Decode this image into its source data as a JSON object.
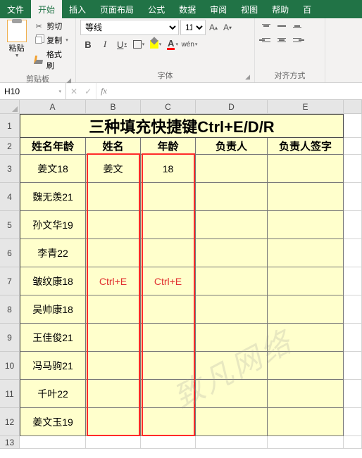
{
  "ribbon": {
    "tabs": [
      "文件",
      "开始",
      "插入",
      "页面布局",
      "公式",
      "数据",
      "审阅",
      "视图",
      "帮助",
      "百"
    ],
    "active_tab": "开始",
    "clipboard": {
      "paste": "粘贴",
      "cut": "剪切",
      "copy": "复制",
      "format_painter": "格式刷",
      "group": "剪贴板"
    },
    "font": {
      "name": "等线",
      "size": "11",
      "bold": "B",
      "italic": "I",
      "underline": "U",
      "ruby": "wén",
      "fontcolor_letter": "A",
      "group": "字体"
    },
    "align": {
      "group": "对齐方式"
    }
  },
  "namebar": {
    "ref": "H10",
    "fx": "fx",
    "formula": ""
  },
  "grid": {
    "cols": [
      "A",
      "B",
      "C",
      "D",
      "E"
    ],
    "row_nums": [
      "1",
      "2",
      "3",
      "4",
      "5",
      "6",
      "7",
      "8",
      "9",
      "10",
      "11",
      "12",
      "13"
    ],
    "title": "三种填充快捷键Ctrl+E/D/R",
    "headers": [
      "姓名年龄",
      "姓名",
      "年龄",
      "负责人",
      "负责人签字"
    ],
    "rows": [
      {
        "a": "姜文18",
        "b": "姜文",
        "c": "18"
      },
      {
        "a": "魏无羡21",
        "b": "",
        "c": ""
      },
      {
        "a": "孙文华19",
        "b": "",
        "c": ""
      },
      {
        "a": "李青22",
        "b": "",
        "c": ""
      },
      {
        "a": "皱纹康18",
        "b": "Ctrl+E",
        "c": "Ctrl+E",
        "hint": true
      },
      {
        "a": "吴帅康18",
        "b": "",
        "c": ""
      },
      {
        "a": "王佳俊21",
        "b": "",
        "c": ""
      },
      {
        "a": "冯马驹21",
        "b": "",
        "c": ""
      },
      {
        "a": "千叶22",
        "b": "",
        "c": ""
      },
      {
        "a": "姜文玉19",
        "b": "",
        "c": ""
      }
    ]
  },
  "watermark": "致凡网络"
}
